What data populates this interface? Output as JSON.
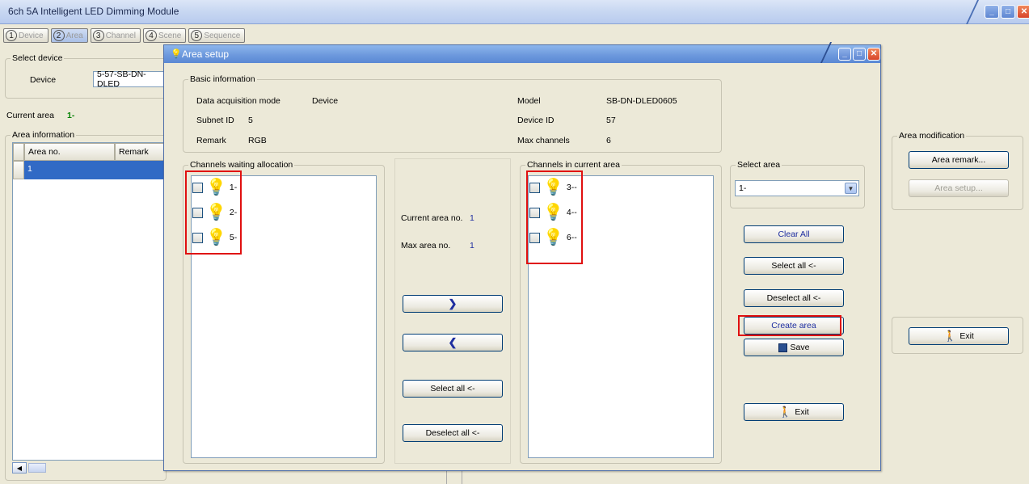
{
  "window": {
    "title": "6ch 5A Intelligent LED Dimming Module"
  },
  "steps": [
    {
      "num": "1",
      "label": "Device"
    },
    {
      "num": "2",
      "label": "Area"
    },
    {
      "num": "3",
      "label": "Channel"
    },
    {
      "num": "4",
      "label": "Scene"
    },
    {
      "num": "5",
      "label": "Sequence"
    }
  ],
  "left": {
    "select_device_title": "Select device",
    "device_label": "Device",
    "device_value": "5-57-SB-DN-DLED",
    "current_area_label": "Current area",
    "current_area_value": "1-",
    "area_info_title": "Area information",
    "grid_headers": [
      "Area no.",
      "Remark"
    ],
    "grid_rows": [
      [
        "1",
        ""
      ]
    ]
  },
  "right": {
    "area_mod_title": "Area modification",
    "area_remark_button": "Area remark...",
    "area_setup_button": "Area setup...",
    "exit_button": "Exit"
  },
  "dialog": {
    "title": "Area setup",
    "basic_info_title": "Basic information",
    "daq_label": "Data acquisition mode",
    "daq_value": "Device",
    "subnet_label": "Subnet ID",
    "subnet_value": "5",
    "remark_label": "Remark",
    "remark_value": "RGB",
    "model_label": "Model",
    "model_value": "SB-DN-DLED0605",
    "device_id_label": "Device ID",
    "device_id_value": "57",
    "max_channels_label": "Max channels",
    "max_channels_value": "6",
    "waiting_title": "Channels waiting allocation",
    "waiting_channels": [
      "1-",
      "2-",
      "5-"
    ],
    "current_area_no_label": "Current area no.",
    "current_area_no_value": "1",
    "max_area_no_label": "Max area no.",
    "max_area_no_value": "1",
    "move_right_glyph": "❯",
    "move_left_glyph": "❮",
    "select_all_button": "Select all <-",
    "deselect_all_button": "Deselect all <-",
    "in_area_title": "Channels in current area",
    "in_area_channels": [
      "3--",
      "4--",
      "6--"
    ],
    "select_area_title": "Select area",
    "select_area_value": "1-",
    "clear_all_button": "Clear All",
    "select_all_right_button": "Select all <-",
    "deselect_all_right_button": "Deselect all <-",
    "create_area_button": "Create area",
    "save_button": "Save",
    "exit_button": "Exit"
  },
  "colors": {
    "highlight_red": "#e01010",
    "selection_blue": "#316ac5",
    "title_blue": "#6d99dd"
  }
}
